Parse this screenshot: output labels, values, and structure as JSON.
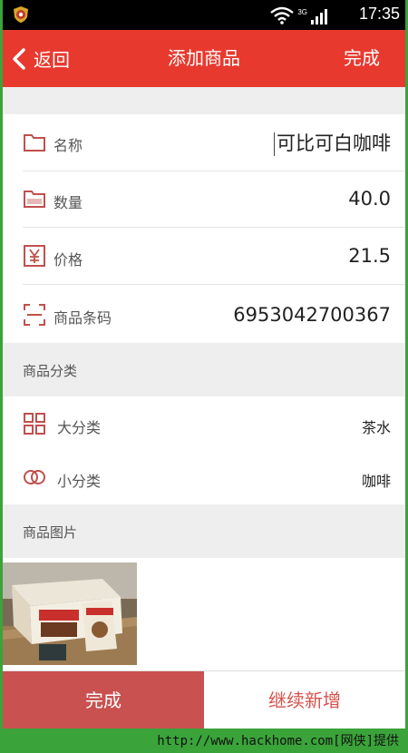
{
  "status_bar": {
    "time": "17:35",
    "network": "3G"
  },
  "header": {
    "back_label": "返回",
    "title": "添加商品",
    "done_label": "完成"
  },
  "fields": [
    {
      "label": "名称",
      "value": "可比可白咖啡",
      "icon": "folder-outline-icon"
    },
    {
      "label": "数量",
      "value": "40.0",
      "icon": "folder-filled-icon"
    },
    {
      "label": "价格",
      "value": "21.5",
      "icon": "yen-icon"
    },
    {
      "label": "商品条码",
      "value": "6953042700367",
      "icon": "barcode-scan-icon"
    }
  ],
  "category_section": {
    "title": "商品分类",
    "items": [
      {
        "label": "大分类",
        "value": "茶水",
        "icon": "grid-icon"
      },
      {
        "label": "小分类",
        "value": "咖啡",
        "icon": "rings-icon"
      }
    ]
  },
  "image_section": {
    "title": "商品图片"
  },
  "footer": {
    "done_label": "完成",
    "add_more_label": "继续新增"
  },
  "watermark": "http://www.hackhome.com[网侠]提供",
  "colors": {
    "primary": "#e8392e",
    "done_button": "#c9514f",
    "icon": "#c0504d",
    "frame": "#3aa33a"
  }
}
